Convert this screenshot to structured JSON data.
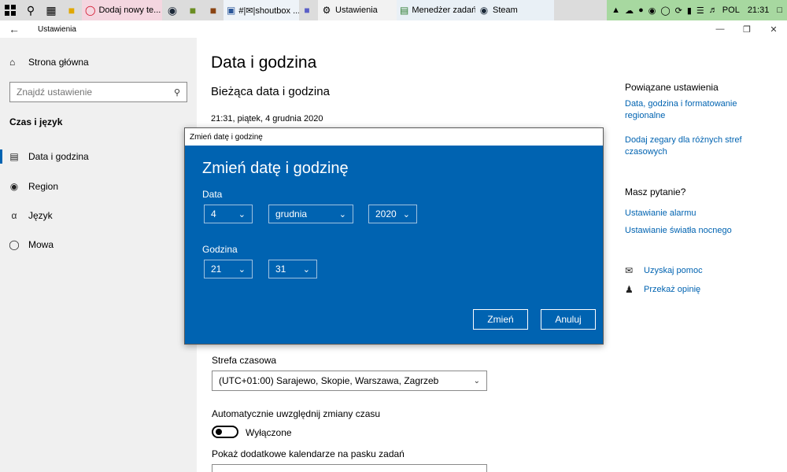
{
  "taskbar": {
    "apps": [
      {
        "label": "Dodaj nowy te..."
      },
      {
        "label": "#|✉|shoutbox ..."
      },
      {
        "label": "Ustawienia"
      },
      {
        "label": "Menedżer zadań"
      },
      {
        "label": "Steam"
      }
    ],
    "tray": {
      "lang": "POL",
      "time": "21:31"
    }
  },
  "window": {
    "title": "Ustawienia"
  },
  "sidebar": {
    "home": "Strona główna",
    "search_placeholder": "Znajdź ustawienie",
    "section": "Czas i język",
    "items": [
      {
        "label": "Data i godzina"
      },
      {
        "label": "Region"
      },
      {
        "label": "Język"
      },
      {
        "label": "Mowa"
      }
    ]
  },
  "main": {
    "title": "Data i godzina",
    "subtitle": "Bieżąca data i godzina",
    "current": "21:31, piątek, 4 grudnia 2020",
    "timezone_label": "Strefa czasowa",
    "timezone_value": "(UTC+01:00) Sarajewo, Skopie, Warszawa, Zagrzeb",
    "dst_label": "Automatycznie uwzględnij zmiany czasu",
    "dst_state": "Wyłączone",
    "calendars_label": "Pokaż dodatkowe kalendarze na pasku zadań"
  },
  "related": {
    "heading": "Powiązane ustawienia",
    "link1": "Data, godzina i formatowanie regionalne",
    "link2": "Dodaj zegary dla różnych stref czasowych",
    "question": "Masz pytanie?",
    "link3": "Ustawianie alarmu",
    "link4": "Ustawianie światła nocnego",
    "help": "Uzyskaj pomoc",
    "feedback": "Przekaż opinię"
  },
  "dialog": {
    "title": "Zmień datę i godzinę",
    "heading": "Zmień datę i godzinę",
    "date_label": "Data",
    "day": "4",
    "month": "grudnia",
    "year": "2020",
    "time_label": "Godzina",
    "hour": "21",
    "minute": "31",
    "ok": "Zmień",
    "cancel": "Anuluj"
  }
}
